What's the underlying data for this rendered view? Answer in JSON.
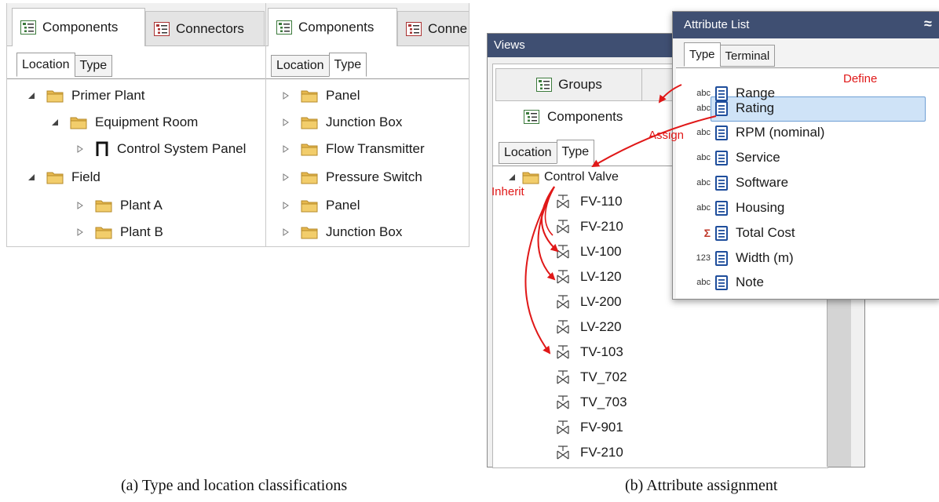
{
  "panel1": {
    "tabs": [
      "Components",
      "Connectors"
    ],
    "subtabs": [
      "Location",
      "Type"
    ],
    "tree": [
      {
        "label": "Primer Plant",
        "level": 0,
        "expanded": true,
        "icon": "folder"
      },
      {
        "label": "Equipment Room",
        "level": 1,
        "expanded": true,
        "icon": "folder"
      },
      {
        "label": "Control System Panel",
        "level": 2,
        "expanded": false,
        "icon": "panel-symbol"
      },
      {
        "label": "Field",
        "level": 0,
        "expanded": true,
        "icon": "folder"
      },
      {
        "label": "Plant A",
        "level": 1,
        "expanded": false,
        "icon": "folder"
      },
      {
        "label": "Plant B",
        "level": 1,
        "expanded": false,
        "icon": "folder"
      }
    ]
  },
  "panel2": {
    "tabs": [
      "Components",
      "Conne"
    ],
    "subtabs": [
      "Location",
      "Type"
    ],
    "tree": [
      "Panel",
      "Junction Box",
      "Flow Transmitter",
      "Pressure Switch",
      "Panel",
      "Junction Box"
    ]
  },
  "views": {
    "title": "Views",
    "buttons": [
      "Groups",
      "Components"
    ],
    "subtabs": [
      "Location",
      "Type"
    ],
    "root": "Control Valve",
    "items": [
      "FV-110",
      "FV-210",
      "LV-100",
      "LV-120",
      "LV-200",
      "LV-220",
      "TV-103",
      "TV_702",
      "TV_703",
      "FV-901",
      "FV-210"
    ]
  },
  "attributes": {
    "title": "Attribute List",
    "collapse_glyph": "≈",
    "subtabs": [
      "Type",
      "Terminal"
    ],
    "rows": [
      {
        "prefix": "abc",
        "label": "Range"
      },
      {
        "prefix": "abc",
        "label": "Rating"
      },
      {
        "prefix": "abc",
        "label": "RPM (nominal)"
      },
      {
        "prefix": "abc",
        "label": "Service"
      },
      {
        "prefix": "abc",
        "label": "Software"
      },
      {
        "prefix": "abc",
        "label": "Housing"
      },
      {
        "prefix": "Σ",
        "label": "Total Cost"
      },
      {
        "prefix": "123",
        "label": "Width (m)"
      },
      {
        "prefix": "abc",
        "label": "Note"
      }
    ],
    "selected_index": 1
  },
  "annotations": {
    "define": "Define",
    "assign": "Assign",
    "inherit": "Inherit",
    "color": "#e01818"
  },
  "captions": {
    "a": "(a)   Type and location classifications",
    "b": "(b)   Attribute assignment"
  },
  "colors": {
    "selection": "#cfe3f7",
    "selection_border": "#6f9fd4",
    "header": "#3f4f72",
    "folder": "#e6b84f"
  }
}
